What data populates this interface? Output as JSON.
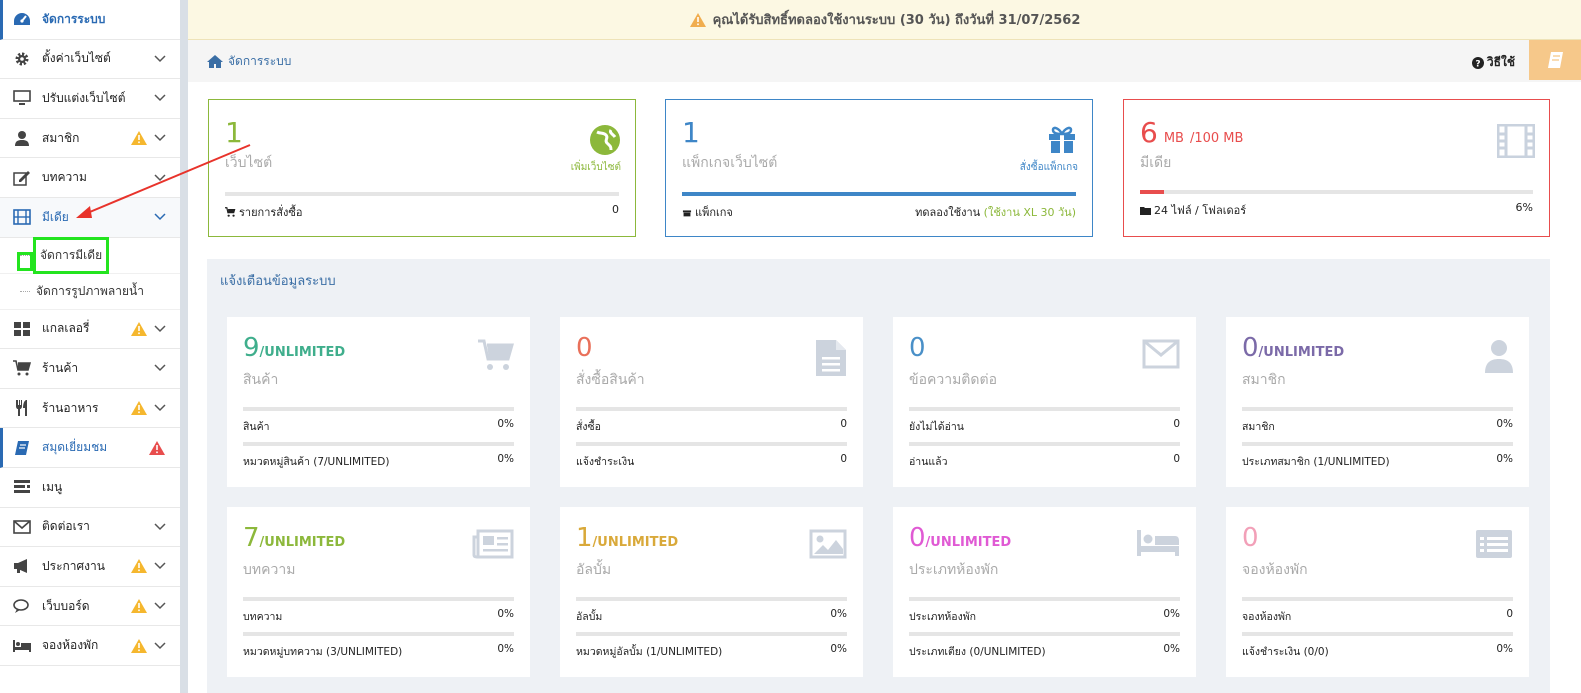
{
  "notice": {
    "text": "คุณได้รับสิทธิ์ทดลองใช้งานระบบ (30 วัน) ถึงวันที่ 31/07/2562"
  },
  "breadcrumb": {
    "home": "จัดการระบบ"
  },
  "howto": {
    "label": "วิธีใช้"
  },
  "sidebar": {
    "items": [
      {
        "label": "จัดการระบบ"
      },
      {
        "label": "ตั้งค่าเว็บไซต์"
      },
      {
        "label": "ปรับแต่งเว็บไซต์"
      },
      {
        "label": "สมาชิก"
      },
      {
        "label": "บทความ"
      },
      {
        "label": "มีเดีย"
      },
      {
        "label": "แกลเลอรี่"
      },
      {
        "label": "ร้านค้า"
      },
      {
        "label": "ร้านอาหาร"
      },
      {
        "label": "สมุดเยี่ยมชม"
      },
      {
        "label": "เมนู"
      },
      {
        "label": "ติดต่อเรา"
      },
      {
        "label": "ประกาศงาน"
      },
      {
        "label": "เว็บบอร์ด"
      },
      {
        "label": "จองห้องพัก"
      }
    ],
    "subitems": [
      {
        "label": "จัดการมีเดีย"
      },
      {
        "label": "จัดการรูปภาพลายน้ำ"
      }
    ]
  },
  "cards": {
    "website": {
      "num": "1",
      "sub": "เว็บไซต์",
      "action": "เพิ่มเว็บไซต์",
      "foot_label": "รายการสั่งซื้อ",
      "foot_value": "0",
      "color": "#8cb83b"
    },
    "package": {
      "num": "1",
      "sub": "แพ็กเกจเว็บไซต์",
      "action": "สั่งซื้อแพ็กเกจ",
      "foot_label": "แพ็กเกจ",
      "foot_value_prefix": "ทดลองใช้งาน",
      "foot_value": "(ใช้งาน XL 30 วัน)",
      "progress": 1.0,
      "color": "#3e86c7"
    },
    "media": {
      "num": "6",
      "unit": "MB",
      "limit": "/100 MB",
      "sub": "มีเดีย",
      "foot_label": "24 ไฟล์ / โฟลเดอร์",
      "foot_value": "6%",
      "progress": 0.06,
      "color": "#e84d4d"
    }
  },
  "panel": {
    "title": "แจ้งเตือนข้อมูลระบบ",
    "stats": [
      {
        "num": "9",
        "unit": "/UNLIMITED",
        "sub": "สินค้า",
        "icon": "cart-icon",
        "color": "#3fae8c",
        "r1l": "สินค้า",
        "r1v": "0%",
        "r2l": "หมวดหมู่สินค้า (7/UNLIMITED)",
        "r2v": "0%"
      },
      {
        "num": "0",
        "unit": "",
        "sub": "สั่งซื้อสินค้า",
        "icon": "document-icon",
        "color": "#e9705a",
        "r1l": "สั่งซื้อ",
        "r1v": "0",
        "r2l": "แจ้งชำระเงิน",
        "r2v": "0"
      },
      {
        "num": "0",
        "unit": "",
        "sub": "ข้อความติดต่อ",
        "icon": "envelope-icon",
        "color": "#4a90c8",
        "r1l": "ยังไม่ได้อ่าน",
        "r1v": "0",
        "r2l": "อ่านแล้ว",
        "r2v": "0"
      },
      {
        "num": "0",
        "unit": "/UNLIMITED",
        "sub": "สมาชิก",
        "icon": "user-icon",
        "color": "#7b6aa8",
        "r1l": "สมาชิก",
        "r1v": "0%",
        "r2l": "ประเภทสมาชิก (1/UNLIMITED)",
        "r2v": "0%"
      },
      {
        "num": "7",
        "unit": "/UNLIMITED",
        "sub": "บทความ",
        "icon": "newspaper-icon",
        "color": "#8cb83b",
        "r1l": "บทความ",
        "r1v": "0%",
        "r2l": "หมวดหมู่บทความ (3/UNLIMITED)",
        "r2v": "0%"
      },
      {
        "num": "1",
        "unit": "/UNLIMITED",
        "sub": "อัลบั้ม",
        "icon": "image-icon",
        "color": "#d9a93a",
        "r1l": "อัลบั้ม",
        "r1v": "0%",
        "r2l": "หมวดหมู่อัลบั้ม (1/UNLIMITED)",
        "r2v": "0%"
      },
      {
        "num": "0",
        "unit": "/UNLIMITED",
        "sub": "ประเภทห้องพัก",
        "icon": "bed-icon",
        "color": "#e05ad4",
        "r1l": "ประเภทห้องพัก",
        "r1v": "0%",
        "r2l": "ประเภทเตียง (0/UNLIMITED)",
        "r2v": "0%"
      },
      {
        "num": "0",
        "unit": "",
        "sub": "จองห้องพัก",
        "icon": "list-icon",
        "color": "#f2a0b8",
        "r1l": "จองห้องพัก",
        "r1v": "0",
        "r2l": "แจ้งชำระเงิน (0/0)",
        "r2v": "0%"
      }
    ]
  }
}
